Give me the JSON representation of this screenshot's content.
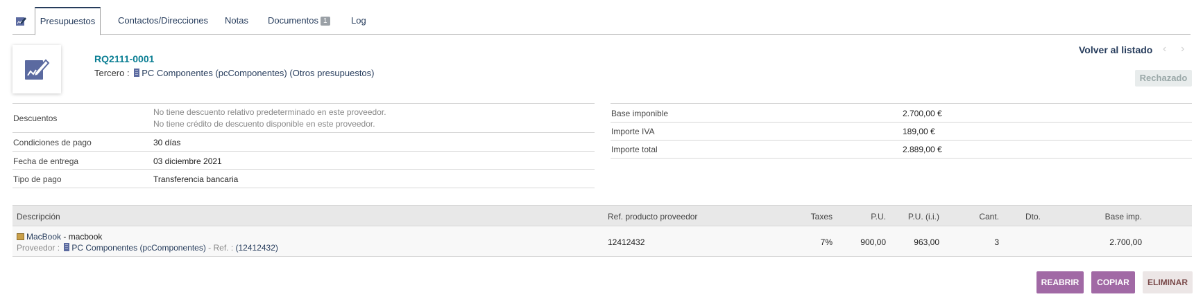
{
  "tabs": [
    {
      "label": "Presupuestos",
      "active": true
    },
    {
      "label": "Contactos/Direcciones"
    },
    {
      "label": "Notas"
    },
    {
      "label": "Documentos",
      "badge": "1"
    },
    {
      "label": "Log"
    }
  ],
  "header": {
    "ref": "RQ2111-0001",
    "tercero_label": "Tercero :",
    "tercero_name": "PC Componentes (pcComponentes)",
    "otros": "(Otros presupuestos)",
    "volver": "Volver al listado",
    "prev": "‹",
    "next": "›",
    "status": "Rechazado"
  },
  "left_fields": {
    "descuentos_label": "Descuentos",
    "descuentos_line1": "No tiene descuento relativo predeterminado en este proveedor.",
    "descuentos_line2": "No tiene crédito de descuento disponible en este proveedor.",
    "condiciones_label": "Condiciones de pago",
    "condiciones_value": "30 días",
    "fecha_label": "Fecha de entrega",
    "fecha_value": "03 diciembre 2021",
    "tipo_label": "Tipo de pago",
    "tipo_value": "Transferencia bancaria"
  },
  "right_fields": {
    "base_label": "Base imponible",
    "base_value": "2.700,00 €",
    "iva_label": "Importe IVA",
    "iva_value": "189,00 €",
    "total_label": "Importe total",
    "total_value": "2.889,00 €"
  },
  "lines_header": {
    "descripcion": "Descripción",
    "ref": "Ref. producto proveedor",
    "taxes": "Taxes",
    "pu": "P.U.",
    "pu_ii": "P.U. (i.i.)",
    "cant": "Cant.",
    "dto": "Dto.",
    "base": "Base imp."
  },
  "lines": [
    {
      "product_ref": "MacBook",
      "product_label": " - macbook",
      "proveedor_label": "Proveedor :",
      "proveedor_name": "PC Componentes (pcComponentes)",
      "ref_sep": " - Ref. :",
      "ref_value": "(12412432)",
      "ref_col": "12412432",
      "taxes": "7%",
      "pu": "900,00",
      "pu_ii": "963,00",
      "cant": "3",
      "dto": "",
      "base": "2.700,00"
    }
  ],
  "buttons": {
    "reabrir": "REABRIR",
    "copiar": "COPIAR",
    "eliminar": "ELIMINAR"
  },
  "colors": {
    "accent": "#263c5c",
    "ref_color": "#0a7e93",
    "button_purple": "#a169a5"
  }
}
